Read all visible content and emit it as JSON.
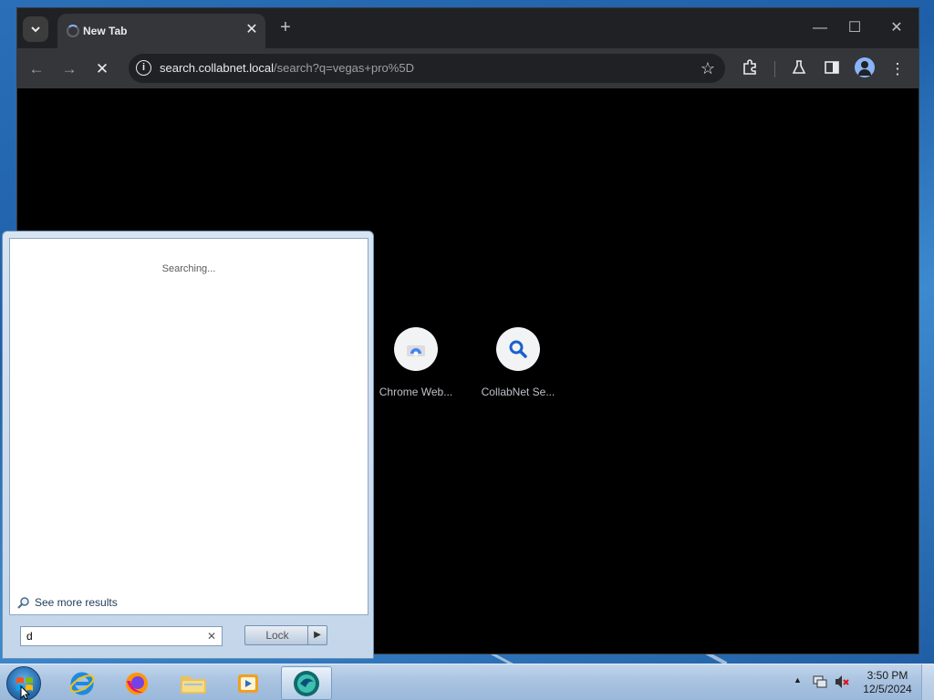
{
  "browser": {
    "tab": {
      "title": "New Tab"
    },
    "address": {
      "host": "search.collabnet.local",
      "path": "/search?q=vegas+pro%5D"
    },
    "shortcuts": [
      {
        "label": "Chrome Web...",
        "icon": "chrome-web-store-icon"
      },
      {
        "label": "CollabNet Se...",
        "icon": "search-icon"
      }
    ]
  },
  "start_menu": {
    "status": "Searching...",
    "see_more": "See more results",
    "search_value": "d",
    "lock_label": "Lock"
  },
  "taskbar": {
    "pinned": [
      "internet-explorer-icon",
      "firefox-icon",
      "file-explorer-icon",
      "media-player-icon",
      "browser-icon"
    ],
    "clock_time": "3:50 PM",
    "clock_date": "12/5/2024"
  }
}
